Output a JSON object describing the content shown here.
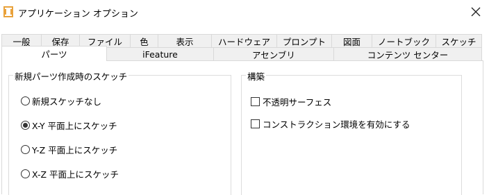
{
  "window": {
    "title": "アプリケーション オプション",
    "app_icon": "inventor-app-icon",
    "close_icon": "close-icon"
  },
  "tabs": {
    "row1": [
      "一般",
      "保存",
      "ファイル",
      "色",
      "表示",
      "ハードウェア",
      "プロンプト",
      "図面",
      "ノートブック",
      "スケッチ"
    ],
    "row2": [
      "パーツ",
      "iFeature",
      "アセンブリ",
      "コンテンツ センター"
    ],
    "active": "パーツ"
  },
  "sketch_group": {
    "title": "新規パーツ作成時のスケッチ",
    "options": [
      {
        "label": "新規スケッチなし",
        "checked": false
      },
      {
        "label": "X-Y 平面上にスケッチ",
        "checked": true
      },
      {
        "label": "Y-Z 平面上にスケッチ",
        "checked": false
      },
      {
        "label": "X-Z 平面上にスケッチ",
        "checked": false
      }
    ]
  },
  "construction_group": {
    "title": "構築",
    "options": [
      {
        "label": "不透明サーフェス",
        "checked": false
      },
      {
        "label": "コンストラクション環境を有効にする",
        "checked": false
      }
    ]
  }
}
